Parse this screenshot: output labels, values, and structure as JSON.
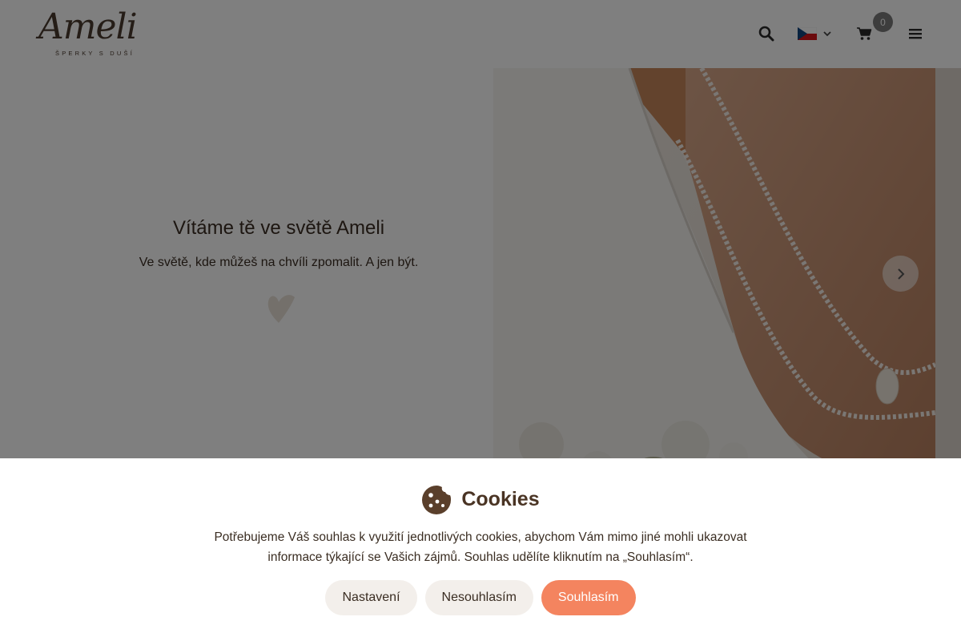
{
  "header": {
    "logo_word": "Ameli",
    "logo_tagline": "ŠPERKY S DUŠÍ",
    "cart_count": "0",
    "language": "cs",
    "icons": [
      "search-icon",
      "czech-flag-icon",
      "chevron-down-icon",
      "cart-icon",
      "hamburger-menu-icon"
    ]
  },
  "hero": {
    "title": "Vítáme tě ve světě Ameli",
    "subtitle": "Ve světě, kde můžeš na chvíli zpomalit. A jen být.",
    "icons": [
      "heart-icon",
      "chevron-right-icon"
    ]
  },
  "cookie": {
    "title": "Cookies",
    "text": "Potřebujeme Váš souhlas k využití jednotlivých cookies, abychom Vám mimo jiné mohli ukazovat informace týkající se Vašich zájmů. Souhlas udělíte kliknutím na „Souhlasím“.",
    "buttons": {
      "settings": "Nastavení",
      "decline": "Nesouhlasím",
      "accept": "Souhlasím"
    },
    "icons": [
      "cookie-icon"
    ]
  },
  "colors": {
    "accent": "#f4845f",
    "brand_text": "#4a3424",
    "secondary_button": "#f3efeb",
    "badge": "#7a7a7a"
  }
}
